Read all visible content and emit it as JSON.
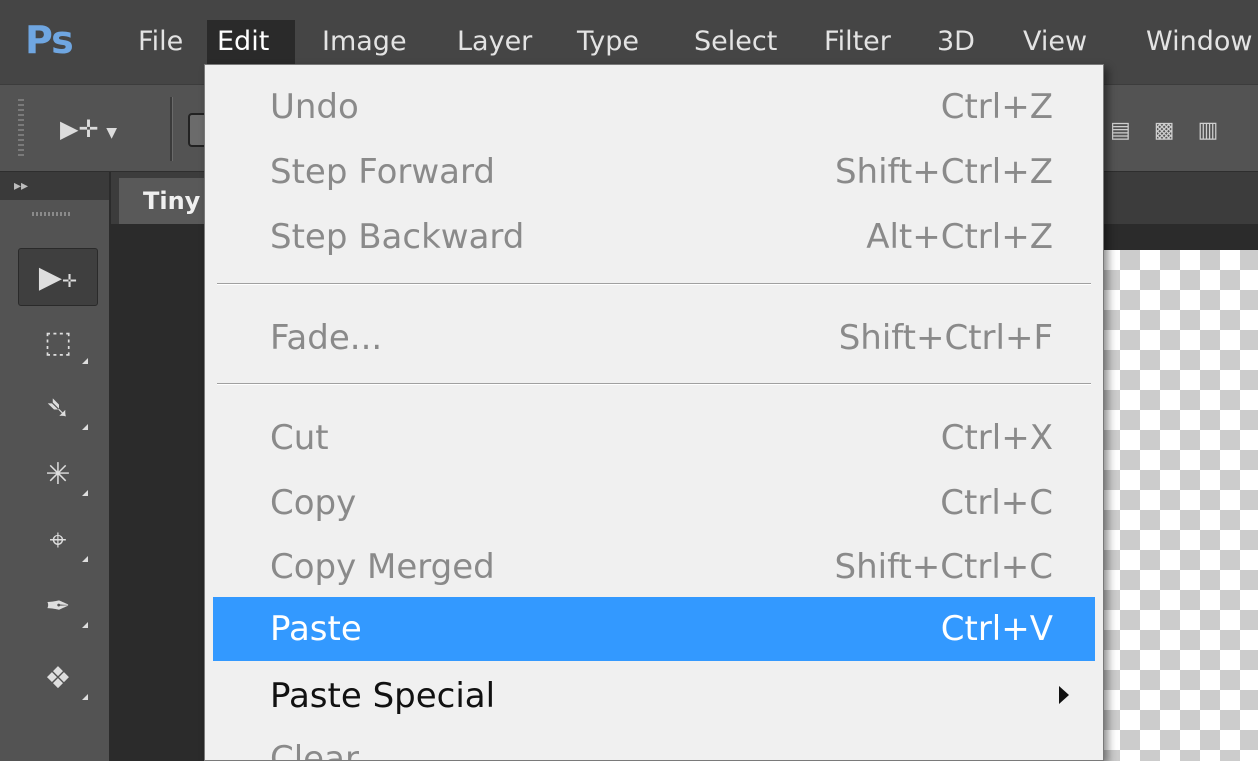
{
  "app": {
    "logo_text": "Ps"
  },
  "menubar": {
    "items": [
      {
        "label": "File"
      },
      {
        "label": "Edit",
        "active": true
      },
      {
        "label": "Image"
      },
      {
        "label": "Layer"
      },
      {
        "label": "Type"
      },
      {
        "label": "Select"
      },
      {
        "label": "Filter"
      },
      {
        "label": "3D"
      },
      {
        "label": "View"
      },
      {
        "label": "Window"
      }
    ]
  },
  "optionsbar": {
    "tool_icon": "move-tool-icon",
    "align_icons": [
      "align-top-edges-icon",
      "align-vertical-centers-icon",
      "align-bottom-edges-icon"
    ]
  },
  "toolbar": {
    "tools": [
      {
        "name": "move-tool-icon",
        "selected": true
      },
      {
        "name": "rectangular-marquee-tool-icon"
      },
      {
        "name": "lasso-tool-icon"
      },
      {
        "name": "magic-wand-tool-icon"
      },
      {
        "name": "crop-tool-icon"
      },
      {
        "name": "eyedropper-tool-icon"
      },
      {
        "name": "healing-brush-tool-icon"
      }
    ]
  },
  "document": {
    "tab_title": "Tiny"
  },
  "edit_menu": {
    "items": [
      {
        "label": "Undo",
        "shortcut": "Ctrl+Z",
        "enabled": false
      },
      {
        "label": "Step Forward",
        "shortcut": "Shift+Ctrl+Z",
        "enabled": false
      },
      {
        "label": "Step Backward",
        "shortcut": "Alt+Ctrl+Z",
        "enabled": false
      },
      {
        "label": "Fade...",
        "shortcut": "Shift+Ctrl+F",
        "enabled": false
      },
      {
        "label": "Cut",
        "shortcut": "Ctrl+X",
        "enabled": false
      },
      {
        "label": "Copy",
        "shortcut": "Ctrl+C",
        "enabled": false
      },
      {
        "label": "Copy Merged",
        "shortcut": "Shift+Ctrl+C",
        "enabled": false
      },
      {
        "label": "Paste",
        "shortcut": "Ctrl+V",
        "enabled": true,
        "highlighted": true
      },
      {
        "label": "Paste Special",
        "shortcut": "",
        "enabled": true,
        "submenu": true
      },
      {
        "label": "Clear",
        "shortcut": "",
        "enabled": false
      }
    ]
  },
  "colors": {
    "menu_highlight": "#3399ff",
    "logo": "#6fa6e1",
    "menubar_bg": "#454545",
    "menu_bg": "#f0f0f0"
  }
}
